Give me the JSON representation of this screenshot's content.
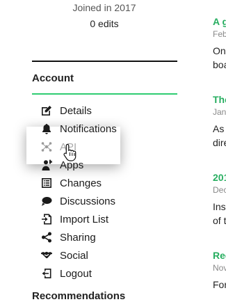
{
  "profile": {
    "joined": "Joined in 2017",
    "edits": "0 edits"
  },
  "account": {
    "title": "Account",
    "items": [
      {
        "label": "Details",
        "icon": "edit-icon"
      },
      {
        "label": "Notifications",
        "icon": "bell-icon"
      },
      {
        "label": "API",
        "icon": "api-icon"
      },
      {
        "label": "Apps",
        "icon": "apps-icon"
      },
      {
        "label": "Changes",
        "icon": "list-icon"
      },
      {
        "label": "Discussions",
        "icon": "speech-bubble-icon"
      },
      {
        "label": "Import List",
        "icon": "import-icon"
      },
      {
        "label": "Sharing",
        "icon": "share-icon"
      },
      {
        "label": "Social",
        "icon": "handshake-icon"
      },
      {
        "label": "Logout",
        "icon": "logout-icon"
      }
    ]
  },
  "next_section": {
    "title": "Recommendations"
  },
  "feed": [
    {
      "title": "A g",
      "date": "Feb",
      "lines": [
        "On",
        "boa"
      ]
    },
    {
      "title": "The",
      "date": "Jan",
      "lines": [
        "As",
        "dire"
      ]
    },
    {
      "title": "201",
      "date": "Dec",
      "lines": [
        "Ins",
        "of t"
      ]
    },
    {
      "title": "Reg",
      "date": "Nov",
      "lines": [
        "For"
      ]
    }
  ],
  "colors": {
    "accent_green": "#2ecc71",
    "feed_title_green": "#27ae60"
  }
}
